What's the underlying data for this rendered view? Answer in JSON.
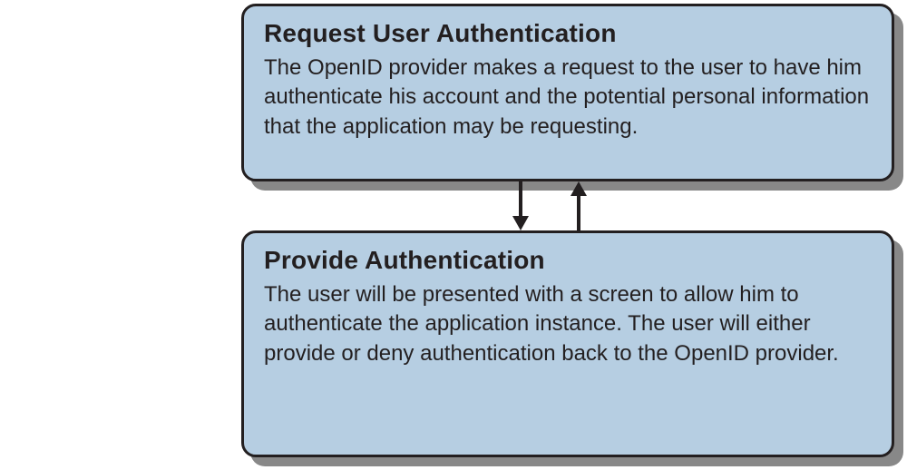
{
  "boxes": {
    "top": {
      "title": "Request User Authentication",
      "body": "The OpenID provider makes a request to the user to have him authenticate his account and the potential personal information that the application may be requesting."
    },
    "bottom": {
      "title": "Provide Authentication",
      "body": "The user will be presented with a screen to allow him to authenticate the application instance. The user will either provide or deny authentication back to the OpenID provider."
    }
  },
  "colors": {
    "box_fill": "#b6cee2",
    "stroke": "#231f20",
    "shadow": "#888888"
  }
}
